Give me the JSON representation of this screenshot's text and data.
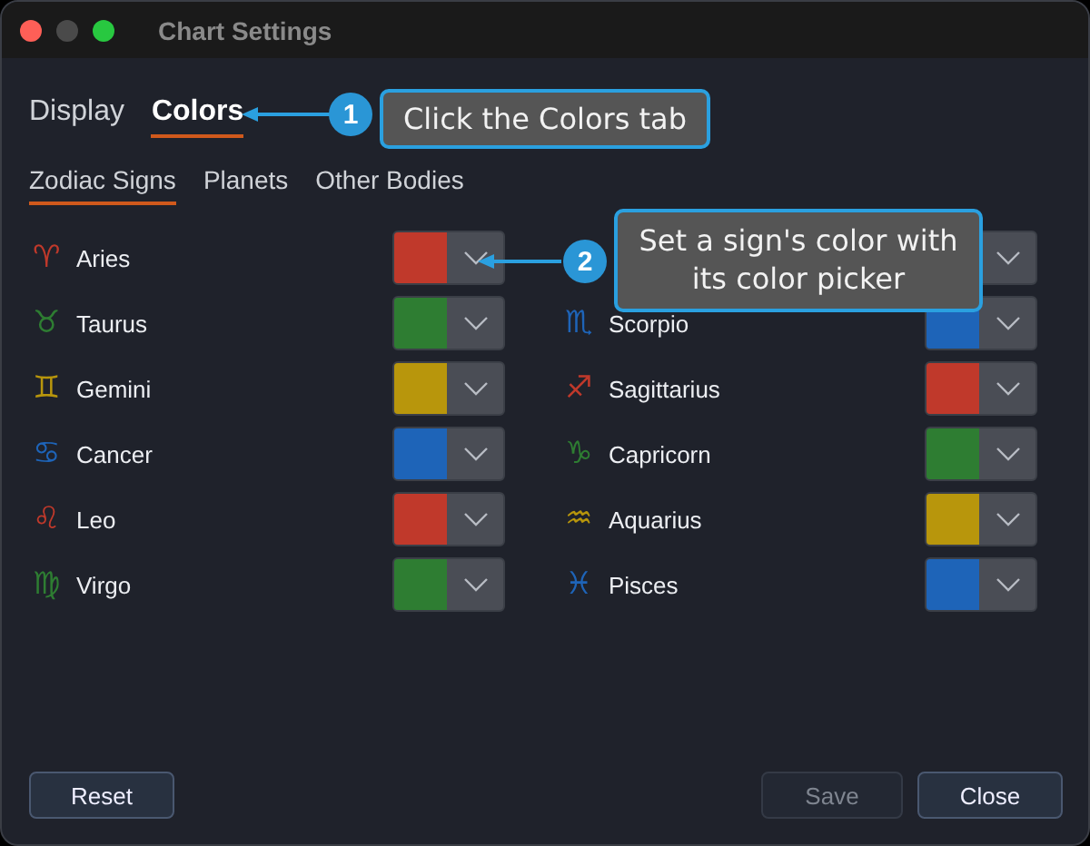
{
  "window": {
    "title": "Chart Settings"
  },
  "tabs": [
    {
      "label": "Display",
      "selected": false
    },
    {
      "label": "Colors",
      "selected": true
    }
  ],
  "subtabs": [
    {
      "label": "Zodiac Signs",
      "selected": true
    },
    {
      "label": "Planets",
      "selected": false
    },
    {
      "label": "Other Bodies",
      "selected": false
    }
  ],
  "columns": [
    [
      {
        "kind": "sign",
        "glyph": "♈︎",
        "name": "Aries",
        "color": "#c0392b"
      },
      {
        "kind": "sign",
        "glyph": "♉︎",
        "name": "Taurus",
        "color": "#2e7d32"
      },
      {
        "kind": "sign",
        "glyph": "♊︎",
        "name": "Gemini",
        "color": "#b8960c"
      },
      {
        "kind": "sign",
        "glyph": "♋︎",
        "name": "Cancer",
        "color": "#1e64b8"
      },
      {
        "kind": "sign",
        "glyph": "♌︎",
        "name": "Leo",
        "color": "#c0392b"
      },
      {
        "kind": "sign",
        "glyph": "♍︎",
        "name": "Virgo",
        "color": "#2e7d32"
      }
    ],
    [
      {
        "kind": "covered"
      },
      {
        "kind": "sign",
        "glyph": "♏︎",
        "name": "Scorpio",
        "color": "#1e64b8"
      },
      {
        "kind": "sign",
        "glyph": "♐︎",
        "name": "Sagittarius",
        "color": "#c0392b"
      },
      {
        "kind": "sign",
        "glyph": "♑︎",
        "name": "Capricorn",
        "color": "#2e7d32"
      },
      {
        "kind": "sign",
        "glyph": "♒︎",
        "name": "Aquarius",
        "color": "#b8960c"
      },
      {
        "kind": "sign",
        "glyph": "♓︎",
        "name": "Pisces",
        "color": "#1e64b8"
      }
    ]
  ],
  "buttons": [
    {
      "label": "Reset",
      "disabled": false
    },
    {
      "label": "Save",
      "disabled": true
    },
    {
      "label": "Close",
      "disabled": false
    }
  ],
  "callouts": [
    {
      "number": "1",
      "text": "Click the Colors tab"
    },
    {
      "number": "2",
      "text": "Set a sign's color with its color picker"
    }
  ]
}
